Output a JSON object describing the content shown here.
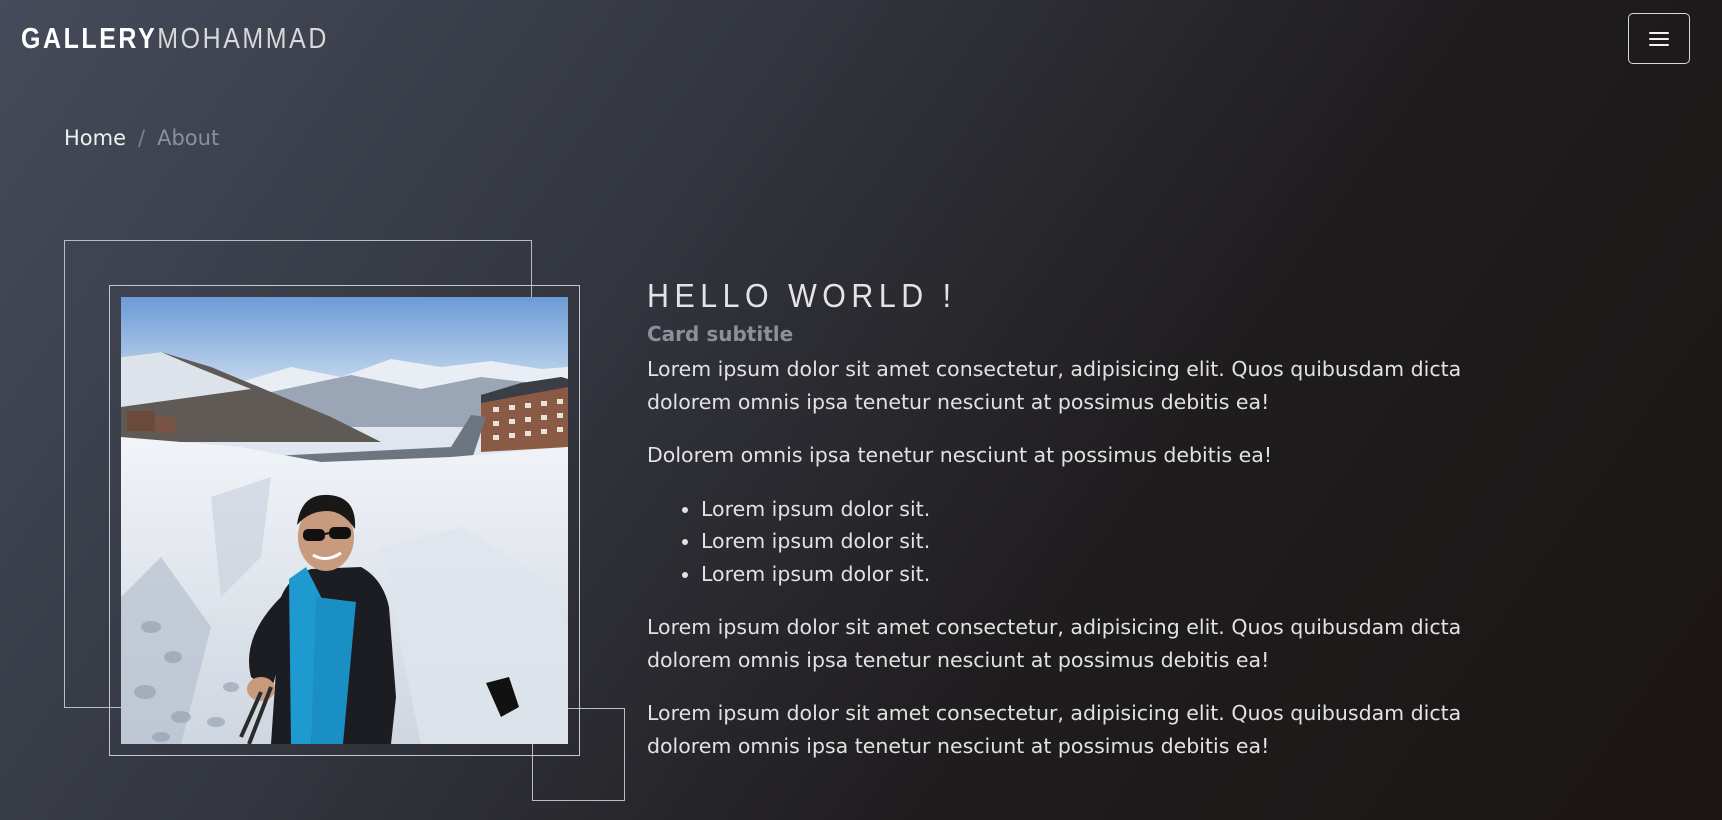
{
  "navbar": {
    "brand_bold": "GALLERY",
    "brand_light": "MOHAMMAD",
    "menu_icon": "hamburger-menu-icon"
  },
  "breadcrumb": {
    "home": "Home",
    "separator": "/",
    "current": "About"
  },
  "card": {
    "title": "HELLO WORLD !",
    "subtitle": "Card subtitle",
    "paragraph1": "Lorem ipsum dolor sit amet consectetur, adipisicing elit. Quos quibusdam dicta dolorem omnis ipsa tenetur nesciunt at possimus debitis ea!",
    "paragraph2": "Dolorem omnis ipsa tenetur nesciunt at possimus debitis ea!",
    "list": [
      "Lorem ipsum dolor sit.",
      "Lorem ipsum dolor sit.",
      "Lorem ipsum dolor sit."
    ],
    "paragraph3": "Lorem ipsum dolor sit amet consectetur, adipisicing elit. Quos quibusdam dicta dolorem omnis ipsa tenetur nesciunt at possimus debitis ea!",
    "paragraph4": "Lorem ipsum dolor sit amet consectetur, adipisicing elit. Quos quibusdam dicta dolorem omnis ipsa tenetur nesciunt at possimus debitis ea!"
  },
  "colors": {
    "background_start": "#454b5a",
    "background_end": "#1b1614",
    "frame_border": "#b9bcc2",
    "muted_text": "#8d9099"
  }
}
